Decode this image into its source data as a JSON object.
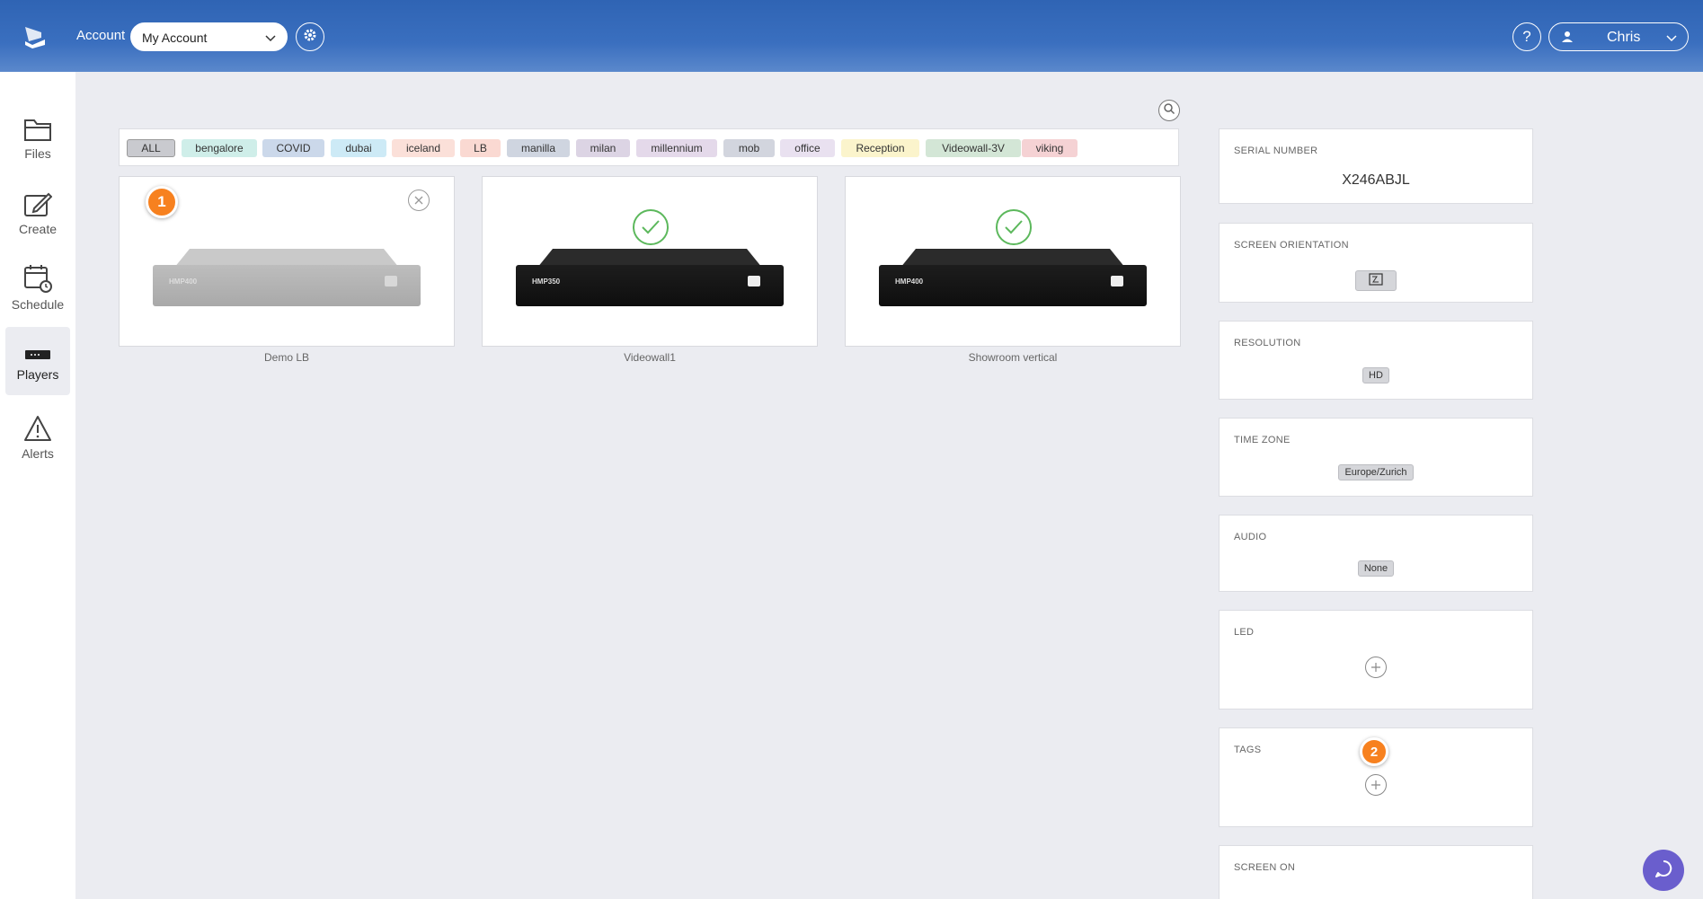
{
  "header": {
    "account_label": "Account",
    "account_selected": "My Account",
    "help_label": "?",
    "user_name": "Chris"
  },
  "sidebar": {
    "items": [
      {
        "label": "Files",
        "icon": "folder-icon"
      },
      {
        "label": "Create",
        "icon": "edit-icon"
      },
      {
        "label": "Schedule",
        "icon": "calendar-clock-icon"
      },
      {
        "label": "Players",
        "icon": "player-icon",
        "active": true
      },
      {
        "label": "Alerts",
        "icon": "warning-icon"
      }
    ]
  },
  "tags": [
    {
      "label": "ALL",
      "color": "#c9cacf"
    },
    {
      "label": "bengalore",
      "color": "#cfeee9"
    },
    {
      "label": "COVID",
      "color": "#cbd8ea"
    },
    {
      "label": "dubai",
      "color": "#cdeaf6"
    },
    {
      "label": "iceland",
      "color": "#fbe0d9"
    },
    {
      "label": "LB",
      "color": "#fad9d2"
    },
    {
      "label": "manilla",
      "color": "#cfd5e0"
    },
    {
      "label": "milan",
      "color": "#dcd4e4"
    },
    {
      "label": "millennium",
      "color": "#e4d9ea"
    },
    {
      "label": "mob",
      "color": "#d2d5de"
    },
    {
      "label": "office",
      "color": "#e9e1f0"
    },
    {
      "label": "Reception",
      "color": "#fbf4cc"
    },
    {
      "label": "Videowall-3V",
      "color": "#d3e6d6"
    },
    {
      "label": "viking",
      "color": "#f5d2d4"
    }
  ],
  "players": [
    {
      "name": "Demo LB",
      "model": "HMP400",
      "status": "offline"
    },
    {
      "name": "Videowall1",
      "model": "HMP350",
      "status": "online"
    },
    {
      "name": "Showroom vertical",
      "model": "HMP400",
      "status": "online"
    }
  ],
  "badges": {
    "one": "1",
    "two": "2"
  },
  "panels": {
    "serial": {
      "title": "SERIAL NUMBER",
      "value": "X246ABJL"
    },
    "orientation": {
      "title": "SCREEN ORIENTATION"
    },
    "resolution": {
      "title": "RESOLUTION",
      "value": "HD"
    },
    "timezone": {
      "title": "TIME ZONE",
      "value": "Europe/Zurich"
    },
    "audio": {
      "title": "AUDIO",
      "value": "None"
    },
    "led": {
      "title": "LED"
    },
    "tags": {
      "title": "TAGS"
    },
    "screen_on": {
      "title": "SCREEN ON"
    }
  },
  "colors": {
    "header": "#3a6fbf",
    "badge": "#f7811f",
    "online": "#5cb85c",
    "chat": "#6a5ecd"
  }
}
